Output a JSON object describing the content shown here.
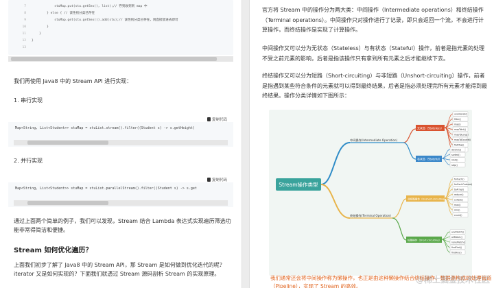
{
  "left": {
    "code_top_lines": [
      {
        "n": "7",
        "text": "            stuMap.put(stu.getSex(), list);// 存到收到到 map 中"
      },
      {
        "n": "8",
        "text": "        } else { // 该性别分类已存在"
      },
      {
        "n": "9",
        "text": "            stuMap.get(stu.getSex()).add(stu);// 该性别分类已存在，则直接放进去即可"
      },
      {
        "n": "10",
        "text": "        }"
      },
      {
        "n": "11",
        "text": "    }"
      },
      {
        "n": "12",
        "text": "}"
      },
      {
        "n": "13",
        "text": ""
      }
    ],
    "intro": "我们再使用 Java8 中的 Stream API 进行实现：",
    "serial_title": "1. 串行实现",
    "copy_label": "复制代码",
    "serial_code": "Map<String, List<Student>> stuMap = stuList.stream().filter((Student s) -> s.getHeight(",
    "parallel_title": "2. 并行实现",
    "parallel_code": "Map<String, List<Student>> stuMap = stuList.parallelStream().filter((Student s) -> s.get",
    "summary": "通过上面两个简单的例子，我们可以发现，Stream 结合 Lambda 表达式实现遍历筛选功能非常得简洁和便捷。",
    "section_heading": "Stream 如何优化遍历？",
    "section_para": "上面我们初步了解了 Java8 中的 Stream API，那 Stream 是如何做到优化迭代的呢？iterator 又是如何实现的？下面我们就透过 Stream 源码剖析 Stream 的实现原理。"
  },
  "right": {
    "p1": "官方将 Stream 中的操作分为两大类：中间操作（Intermediate operations）和终结操作（Terminal operations）。中间操作只对操作进行了记录，即只会返回一个流，不会进行计算操作，而终结操作是实现了计算操作。",
    "p2": "中间操作又可以分为无状态（Stateless）与有状态（Stateful）操作，前者是指元素的处理不受之前元素的影响，后者是指该操作只有拿到所有元素之后才能继续下去。",
    "p3": "终结操作又可以分为短路（Short-circuiting）与非短路（Unshort-circuiting）操作，前者是指遇到某些符合条件的元素就可以得到最终结果，后者是指必须处理完所有元素才能得到最终结果。操作分类详情如下图所示：",
    "diagram": {
      "root": "Stream操作类型",
      "intermediate": "中间操作(Intermediate Operation)",
      "terminal": "终结操作(Terminal Operation)",
      "stateless": "无状态（Stateless）",
      "stateful": "有状态（Stateful）",
      "unshort": "非短路操作（Unshort-circuiting）",
      "short": "短路操作（Short-circuiting）",
      "stateless_items": [
        "unordered()",
        "filter()",
        "map()",
        "mapToInt()",
        "mapToLong()",
        "mapToDouble()",
        "flatMap()",
        "peek()"
      ],
      "stateful_items": [
        "distinct()",
        "sorted()",
        "limit()",
        "skip()"
      ],
      "unshort_items": [
        "forEach()",
        "forEachOrdered()",
        "toArray()",
        "reduce()",
        "collect()",
        "max()",
        "min()",
        "count()"
      ],
      "short_items": [
        "anyMatch()",
        "allMatch()",
        "noneMatch()",
        "findFirst()",
        "findAny()"
      ]
    },
    "orange_text": "我们通常还会将中间操作称为懒操作，也正是由这种懒操作结合终结操作、数据源构成的处理管道（Pipeline），实现了 Stream 的高效。",
    "watermark": "@稀土掘金技术社区"
  }
}
